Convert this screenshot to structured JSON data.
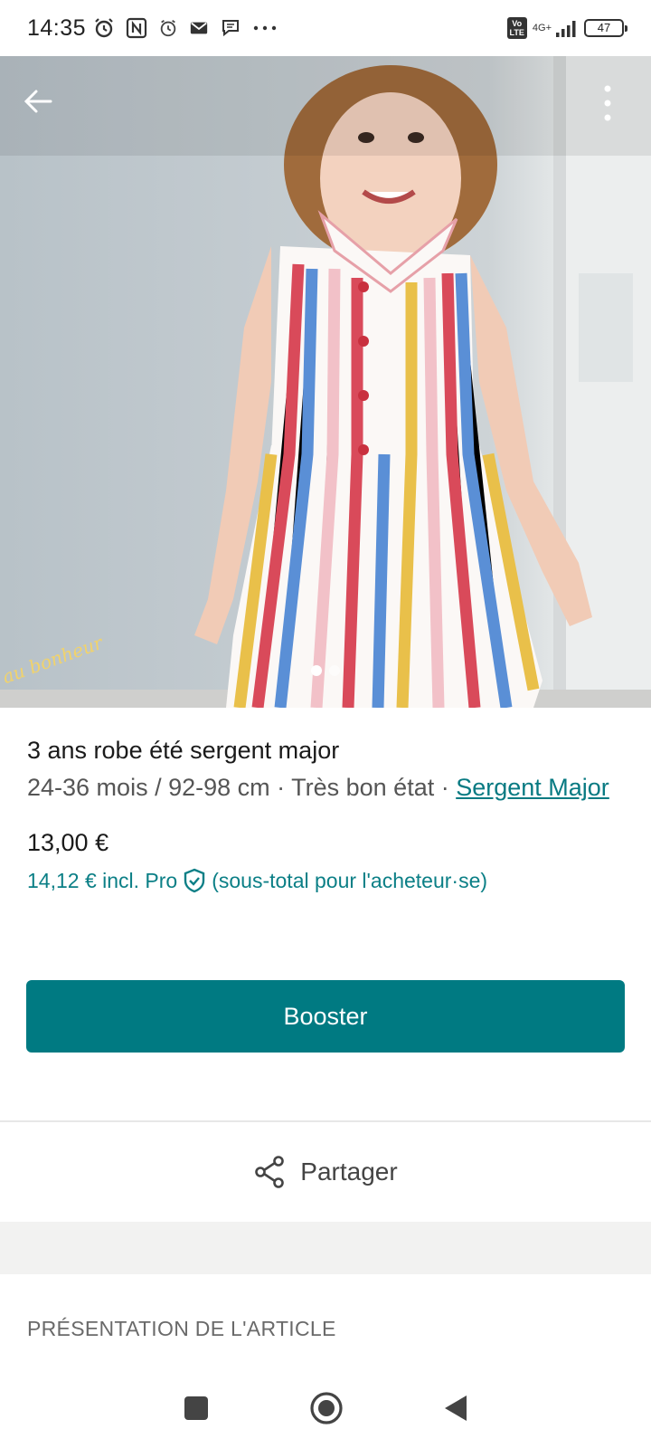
{
  "status_bar": {
    "time": "14:35",
    "network": "4G+",
    "battery": "47",
    "icons": [
      "alarm-icon",
      "nfc-icon",
      "alarm-clock-icon",
      "mail-icon",
      "chat-icon",
      "more-dots-icon",
      "volte-icon",
      "signal-icon",
      "battery-icon"
    ]
  },
  "hero": {
    "watermark": "au bonheur",
    "icons": [
      "back-arrow-icon",
      "more-vertical-icon"
    ],
    "page_indicator": {
      "current": 1,
      "total": 2
    }
  },
  "item": {
    "title": "3 ans robe été sergent major",
    "size_condition": "24-36 mois / 92-98 cm · Très bon état · ",
    "brand": "Sergent Major",
    "price": "13,00 €",
    "price_pro": "14,12 € incl. Pro",
    "price_pro_note": "(sous-total pour l'acheteur·se)"
  },
  "actions": {
    "booster_label": "Booster",
    "share_label": "Partager"
  },
  "sections": {
    "presentation_header": "PRÉSENTATION DE L'ARTICLE"
  },
  "colors": {
    "accent": "#007a82",
    "link": "#087a82"
  }
}
